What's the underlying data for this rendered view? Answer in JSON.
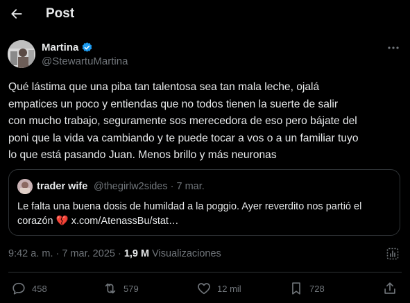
{
  "header": {
    "title": "Post",
    "back_icon": "arrow-left-icon"
  },
  "author": {
    "name": "Martina",
    "handle": "@StewartuMartina",
    "verified": true,
    "verified_color": "#1d9bf0"
  },
  "tweet": {
    "text": "Qué lástima que una piba tan talentosa sea tan mala leche, ojalá\nempatices un poco y entiendas que no todos tienen la suerte de salir\ncon mucho trabajo, seguramente sos merecedora de eso pero bájate del\nponi que la vida va cambiando y te puede tocar a vos o a un familiar tuyo\nlo que está pasando Juan. Menos brillo y más neuronas"
  },
  "quote": {
    "name": "trader wife",
    "handle": "@thegirlw2sides · 7 mar.",
    "text_line1": "Le falta una buena dosis de humildad a la poggio. Ayer reverdito nos partió el",
    "text_prefix": "corazón ",
    "emoji": "💔",
    "link": " x.com/AtenassBu/stat…"
  },
  "meta": {
    "time_date": "9:42 a. m. · 7 mar. 2025 · ",
    "views_count": "1,9 M",
    "views_label": " Visualizaciones"
  },
  "actions": {
    "replies": "458",
    "reposts": "579",
    "likes": "12 mil",
    "bookmarks": "728"
  },
  "colors": {
    "background": "#000000",
    "text": "#e7e9ea",
    "muted": "#71767b",
    "border": "#2f3336",
    "accent": "#1d9bf0"
  }
}
